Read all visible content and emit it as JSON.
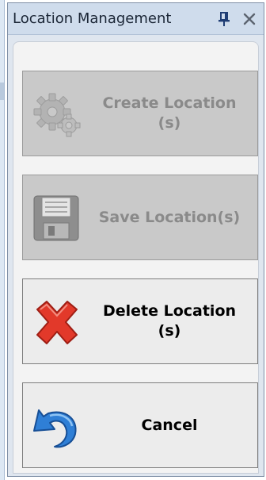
{
  "panel": {
    "title": "Location Management",
    "pin_icon": "pin-icon",
    "close_icon": "close-icon"
  },
  "buttons": [
    {
      "label": "Create Location\n(s)",
      "icon": "gear-icon",
      "enabled": false
    },
    {
      "label": "Save Location(s)",
      "icon": "floppy-disk-icon",
      "enabled": false
    },
    {
      "label": "Delete Location\n(s)",
      "icon": "red-x-icon",
      "enabled": true
    },
    {
      "label": "Cancel",
      "icon": "undo-arrow-icon",
      "enabled": true
    }
  ],
  "colors": {
    "title_bar": "#cfdcec",
    "disabled_button": "#c9c9c9",
    "enabled_button": "#ececec",
    "delete_red": "#e2392a",
    "cancel_blue": "#2f7fd6"
  }
}
